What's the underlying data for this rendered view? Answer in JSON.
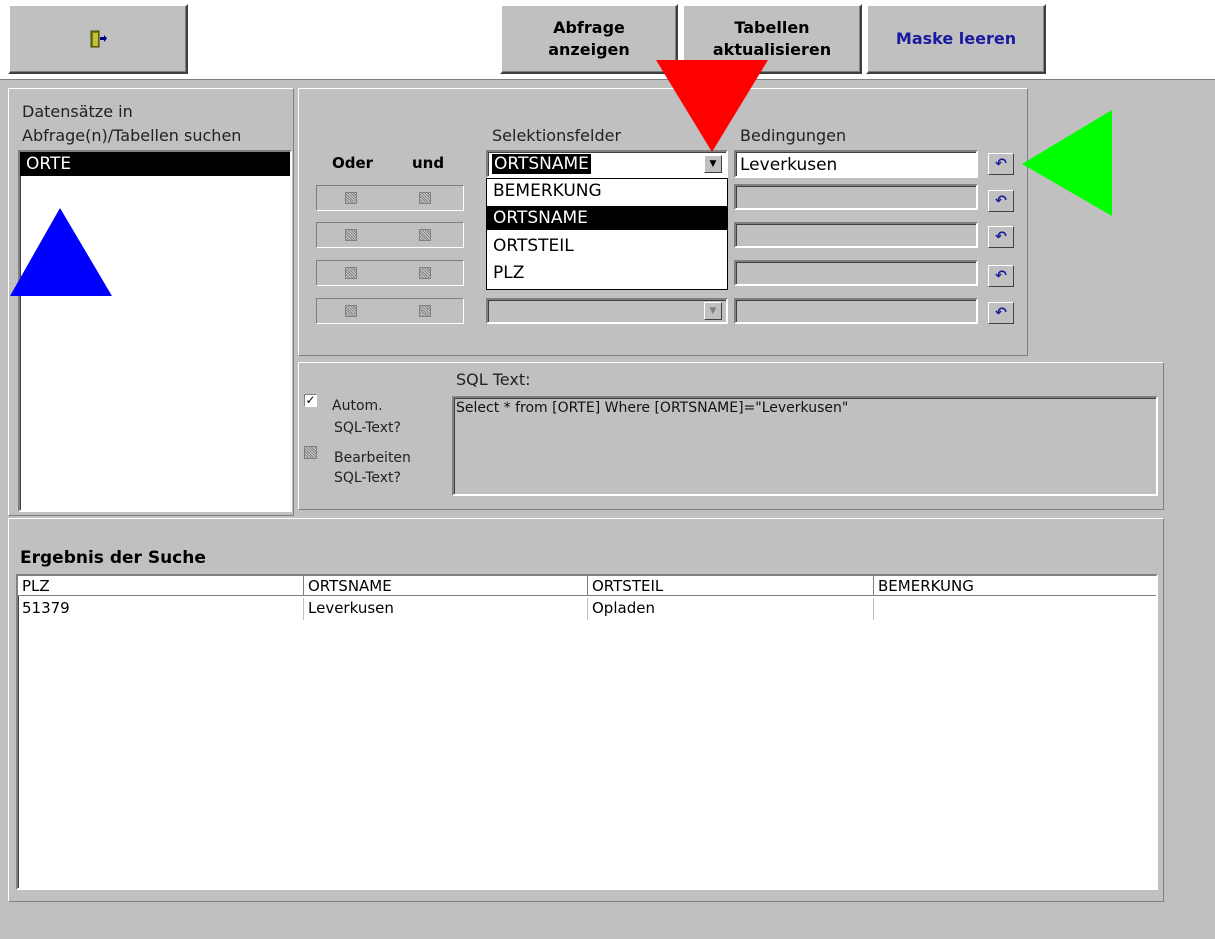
{
  "toolbar": {
    "exit_icon": "door-exit-icon",
    "query_label": "Abfrage\nanzeigen",
    "refresh_label": "Tabellen\naktualisieren",
    "clear_label": "Maske leeren",
    "clear_color": "#1a1aa0"
  },
  "tables_panel": {
    "label_line1": "Datensätze in",
    "label_line2": "Abfrage(n)/Tabellen suchen",
    "items": [
      "ORTE"
    ]
  },
  "selection": {
    "header_oder": "Oder",
    "header_und": "und",
    "header_fields": "Selektionsfelder",
    "header_conditions": "Bedingungen",
    "field1_value": "ORTSNAME",
    "condition1_value": "Leverkusen",
    "dropdown_options": [
      "BEMERKUNG",
      "ORTSNAME",
      "ORTSTEIL",
      "PLZ"
    ],
    "dropdown_selected": "ORTSNAME"
  },
  "sql": {
    "title": "SQL Text:",
    "auto_label_1": "Autom.",
    "auto_label_2": "SQL-Text?",
    "auto_checked": true,
    "edit_label_1": "Bearbeiten",
    "edit_label_2": "SQL-Text?",
    "text": "Select *  from [ORTE] Where [ORTSNAME]=\"Leverkusen\""
  },
  "result": {
    "title": "Ergebnis der Suche",
    "columns": [
      "PLZ",
      "ORTSNAME",
      "ORTSTEIL",
      "BEMERKUNG"
    ],
    "rows": [
      [
        "51379",
        "Leverkusen",
        "Opladen",
        ""
      ]
    ]
  },
  "annotations": {
    "red_arrow_color": "#ff0000",
    "green_arrow_color": "#00ff00",
    "blue_arrow_color": "#0000ff"
  }
}
